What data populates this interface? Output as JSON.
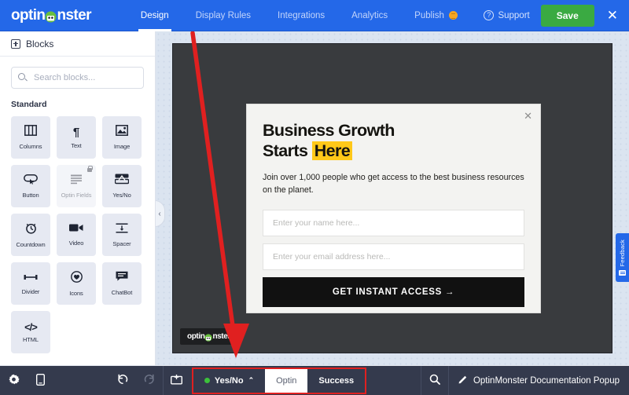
{
  "topbar": {
    "logo_text_left": "optin",
    "logo_text_right": "nster",
    "logo_icon": "monster-mascot-icon",
    "nav": [
      {
        "label": "Design",
        "active": true
      },
      {
        "label": "Display Rules",
        "active": false
      },
      {
        "label": "Integrations",
        "active": false
      },
      {
        "label": "Analytics",
        "active": false
      },
      {
        "label": "Publish",
        "active": false,
        "badge": "orange-status-badge"
      }
    ],
    "support_label": "Support",
    "support_icon": "question-circle-icon",
    "save_label": "Save",
    "close_icon": "close-icon",
    "accent_blue": "#2468e8",
    "save_green": "#3aaa42"
  },
  "sidebar": {
    "header_label": "Blocks",
    "header_icon": "blocks-icon",
    "search": {
      "placeholder": "Search blocks...",
      "value": "",
      "icon": "search-icon"
    },
    "section_label": "Standard",
    "blocks": [
      {
        "label": "Columns",
        "icon": "columns-icon",
        "glyph": "▥",
        "locked": false
      },
      {
        "label": "Text",
        "icon": "paragraph-icon",
        "glyph": "¶",
        "locked": false
      },
      {
        "label": "Image",
        "icon": "image-icon",
        "glyph": "▣",
        "locked": false
      },
      {
        "label": "Button",
        "icon": "button-icon",
        "glyph": "▭",
        "locked": false
      },
      {
        "label": "Optin Fields",
        "icon": "optin-fields-icon",
        "glyph": "▤",
        "locked": true
      },
      {
        "label": "Yes/No",
        "icon": "yes-no-icon",
        "glyph": "⧉",
        "locked": false
      },
      {
        "label": "Countdown",
        "icon": "clock-icon",
        "glyph": "⏰",
        "locked": false
      },
      {
        "label": "Video",
        "icon": "video-camera-icon",
        "glyph": "▶",
        "locked": false
      },
      {
        "label": "Spacer",
        "icon": "spacer-icon",
        "glyph": "↨",
        "locked": false
      },
      {
        "label": "Divider",
        "icon": "divider-icon",
        "glyph": "↔",
        "locked": false
      },
      {
        "label": "Icons",
        "icon": "heart-circle-icon",
        "glyph": "♥",
        "locked": false
      },
      {
        "label": "ChatBot",
        "icon": "chat-bubble-icon",
        "glyph": "▤",
        "locked": false
      },
      {
        "label": "HTML",
        "icon": "code-icon",
        "glyph": "</>",
        "locked": false
      }
    ]
  },
  "canvas": {
    "collapse_icon": "chevron-left-icon",
    "annotation_arrow": "red-arrow-annotation",
    "arrow_color": "#e02020",
    "popup": {
      "close_icon": "close-icon",
      "headline_line1": "Business Growth",
      "headline_line2_prefix": "Starts ",
      "headline_highlight": "Here",
      "highlight_color": "#ffc819",
      "subheadline": "Join over 1,000 people who get access to the best business resources on the planet.",
      "name_field_placeholder": "Enter your name here...",
      "name_field_value": "",
      "email_field_placeholder": "Enter your email address here...",
      "email_field_value": "",
      "cta_label": "GET INSTANT ACCESS →",
      "cta_color": "#111111"
    },
    "watermark_left": "optin",
    "watermark_right": "nster"
  },
  "feedback": {
    "label": "Feedback",
    "icon": "feedback-card-icon"
  },
  "bottombar": {
    "settings_icon": "gear-icon",
    "device_icon": "mobile-device-icon",
    "undo_icon": "undo-icon",
    "redo_icon": "redo-icon",
    "layout_icon": "add-block-icon",
    "search_icon": "search-icon",
    "tabs": [
      {
        "label": "Yes/No",
        "active": false,
        "dot": true,
        "chevron": "⌃"
      },
      {
        "label": "Optin",
        "active": true,
        "dot": false,
        "chevron": ""
      },
      {
        "label": "Success",
        "active": false,
        "dot": false,
        "chevron": ""
      }
    ],
    "highlight_color": "#e02020",
    "campaign_title": "OptinMonster Documentation Popup",
    "campaign_edit_icon": "pencil-icon"
  }
}
